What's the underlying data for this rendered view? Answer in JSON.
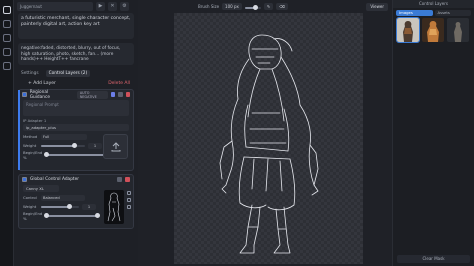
{
  "rail": {
    "icons": [
      "image-icon",
      "canvas-icon",
      "workflow-icon",
      "models-icon",
      "queue-icon"
    ]
  },
  "topbar": {
    "model": "Juggernaut"
  },
  "prompt": {
    "positive": "a futuristic merchant, single character concept, painterly digital art, action key art",
    "negative": "negative:faded, distorted, blurry, out of focus, high saturation, photo, sketch, fan... (more hands)++ HeightT++ fancrane"
  },
  "tabs": [
    {
      "label": "Settings"
    },
    {
      "label": "Control Layers (2)"
    }
  ],
  "layer_actions": {
    "add": "+ Add Layer",
    "delete": "Delete All"
  },
  "regional": {
    "title": "Regional Guidance",
    "auto_badge": "AUTO NEGATIVE",
    "prompt_placeholder": "Regional Prompt",
    "ip_label": "IP Adapter 1",
    "adapter": "ip_adapter_plus",
    "method_label": "Method",
    "method_value": "Full",
    "weight_label": "Weight",
    "weight_value": "1",
    "weight_level": 0.75,
    "begin_end_label": "Begin/End %",
    "begin_end_range": [
      0,
      1
    ]
  },
  "control": {
    "title": "Global Control Adapter",
    "model": "Canny XL",
    "control_label": "Control",
    "control_value": "Balanced",
    "weight_label": "Weight",
    "weight_value": "1",
    "weight_level": 0.75,
    "begin_end_label": "Begin/End %",
    "begin_end_range": [
      0,
      1
    ]
  },
  "canvas": {
    "brush_label": "Brush Size",
    "brush_value": "100 px",
    "viewer_label": "Viewer"
  },
  "right_panel": {
    "title": "Control Layers",
    "tabs": [
      {
        "label": "Images",
        "active": true
      },
      {
        "label": "Assets",
        "active": false
      }
    ],
    "footer": "Clear Mask"
  },
  "colors": {
    "accent": "#3a7bd5",
    "danger": "#e0666f",
    "panel": "#1e2026"
  }
}
